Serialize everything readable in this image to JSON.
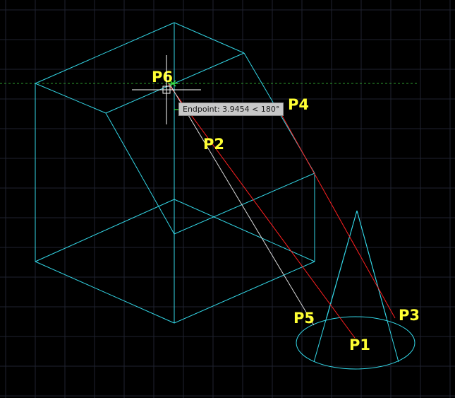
{
  "drawing": {
    "background": "#000000",
    "grid_color": "#1f2230",
    "wire_color": "#33d6e6",
    "line_red_color": "#ff2020",
    "line_white_color": "#d9d9d9",
    "tracking_line_color": "#2e9e2e",
    "label_color": "#ffff33"
  },
  "labels": {
    "p1": "P1",
    "p2": "P2",
    "p3": "P3",
    "p4": "P4",
    "p5": "P5",
    "p6": "P6"
  },
  "tooltip": {
    "text": "Endpoint: 3.9454 < 180°"
  },
  "cursor": {
    "icon": "crosshair-cursor"
  },
  "snap_marker": {
    "icon": "endpoint-snap-marker"
  }
}
